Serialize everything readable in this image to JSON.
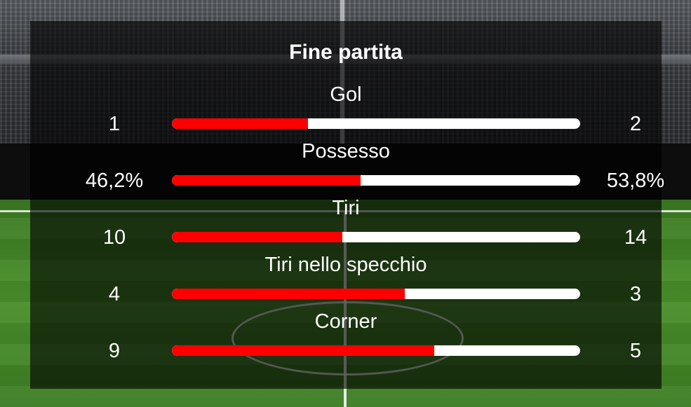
{
  "title": "Fine partita",
  "stats": [
    {
      "label": "Gol",
      "home": "1",
      "away": "2",
      "home_share": 0.333
    },
    {
      "label": "Possesso",
      "home": "46,2%",
      "away": "53,8%",
      "home_share": 0.462
    },
    {
      "label": "Tiri",
      "home": "10",
      "away": "14",
      "home_share": 0.417
    },
    {
      "label": "Tiri nello specchio",
      "home": "4",
      "away": "3",
      "home_share": 0.571
    },
    {
      "label": "Corner",
      "home": "9",
      "away": "5",
      "home_share": 0.643
    }
  ],
  "colors": {
    "home_bar": "#ff0000",
    "away_bar": "#ffffff",
    "panel_overlay": "rgba(0,0,0,0.62)"
  }
}
